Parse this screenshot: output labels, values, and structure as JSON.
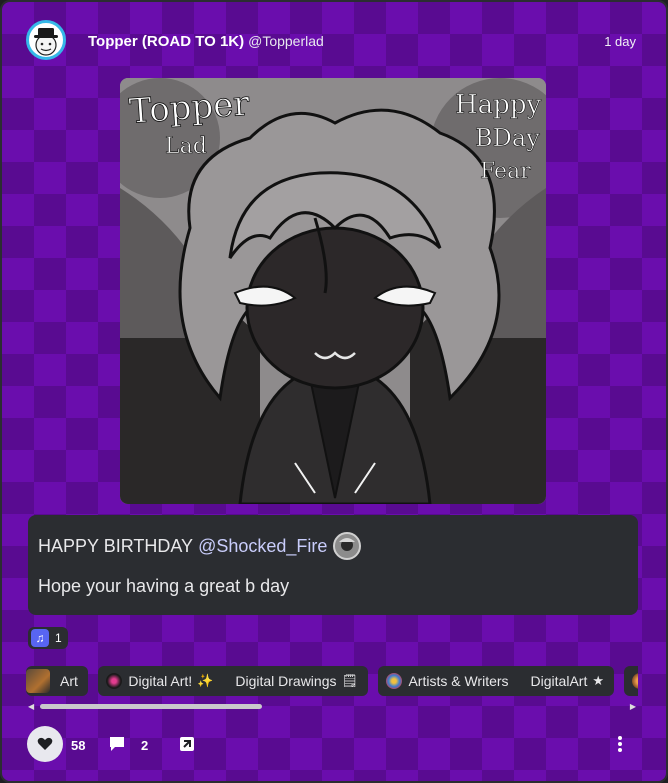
{
  "author": {
    "display_name": "Topper (ROAD TO 1K)",
    "handle": "@Topperlad",
    "avatar_icon": "avatar-icon"
  },
  "post": {
    "time": "1 day",
    "artwork": {
      "text_top_left_line1": "Topper",
      "text_top_left_line2": "Lad",
      "text_top_right_line1": "Happy",
      "text_top_right_line2": "BDay",
      "text_top_right_line3": "Fear"
    },
    "text_line1_prefix": "HAPPY BIRTHDAY",
    "text_line1_mention": "@Shocked_Fire",
    "text_line2": "Hope your having a great b day"
  },
  "reactions": [
    {
      "icon": "music-note-icon",
      "count": "1"
    }
  ],
  "tag_groups": [
    {
      "tags": [
        {
          "label": "Art",
          "icon": "art-thumbnail-icon"
        }
      ]
    },
    {
      "tags": [
        {
          "label": "Digital Art!",
          "suffix": "✨",
          "icon": "sparkle-dot-icon"
        },
        {
          "label": "Digital Drawings",
          "suffix": "🗒"
        }
      ]
    },
    {
      "tags": [
        {
          "label": "Artists & Writers",
          "icon": "palette-icon"
        },
        {
          "label": "DigitalArt",
          "suffix": "★"
        }
      ]
    },
    {
      "tags": [
        {
          "label": "",
          "icon": "orange-badge-icon"
        }
      ]
    }
  ],
  "footer": {
    "like_count": "58",
    "comment_count": "2"
  },
  "colors": {
    "background_purple": "#6a0dad",
    "panel": "#2b2d31",
    "mention": "#c9cdfb",
    "avatar_ring": "#35b8e8"
  }
}
